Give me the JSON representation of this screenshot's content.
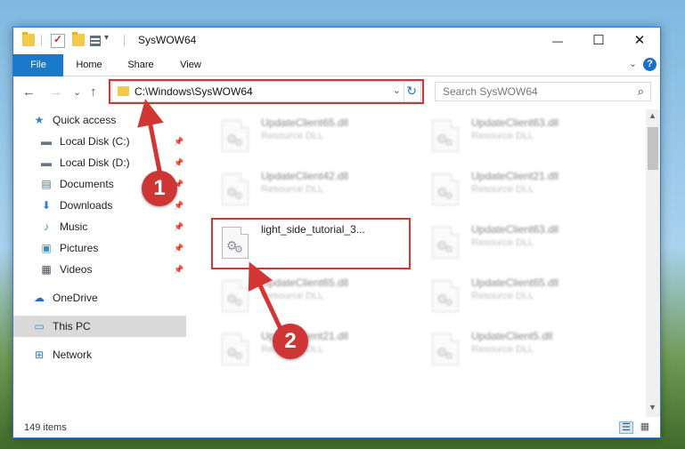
{
  "window": {
    "title": "SysWOW64",
    "controls": {
      "minimize": "—",
      "maximize": "☐",
      "close": "✕"
    }
  },
  "ribbon": {
    "tabs": [
      {
        "label": "File"
      },
      {
        "label": "Home"
      },
      {
        "label": "Share"
      },
      {
        "label": "View"
      }
    ],
    "expand": "⌄",
    "help": "?"
  },
  "nav": {
    "back": "←",
    "forward": "→",
    "recent": "⌄",
    "up": "↑",
    "address": "C:\\Windows\\SysWOW64",
    "address_caret": "⌄",
    "refresh": "↻",
    "search_placeholder": "Search SysWOW64",
    "search_icon": "⌕"
  },
  "sidebar": {
    "items": [
      {
        "label": "Quick access",
        "icon": "star-icon",
        "glyph": "★",
        "color": "#2f7fd6",
        "pinned": false
      },
      {
        "label": "Local Disk (C:)",
        "icon": "drive-icon",
        "glyph": "▬",
        "color": "#6a7580",
        "pinned": true
      },
      {
        "label": "Local Disk (D:)",
        "icon": "drive-icon",
        "glyph": "▬",
        "color": "#6a7580",
        "pinned": true
      },
      {
        "label": "Documents",
        "icon": "documents-icon",
        "glyph": "▤",
        "color": "#4a6f99",
        "pinned": true
      },
      {
        "label": "Downloads",
        "icon": "downloads-icon",
        "glyph": "⬇",
        "color": "#2f7fd6",
        "pinned": true
      },
      {
        "label": "Music",
        "icon": "music-icon",
        "glyph": "♪",
        "color": "#2f7fd6",
        "pinned": true
      },
      {
        "label": "Pictures",
        "icon": "pictures-icon",
        "glyph": "▣",
        "color": "#3a8fc9",
        "pinned": true
      },
      {
        "label": "Videos",
        "icon": "videos-icon",
        "glyph": "▦",
        "color": "#404a55",
        "pinned": true
      },
      {
        "label": "OneDrive",
        "icon": "onedrive-icon",
        "glyph": "☁",
        "color": "#1e6fc7",
        "pinned": false
      },
      {
        "label": "This PC",
        "icon": "computer-icon",
        "glyph": "▭",
        "color": "#3a8fc9",
        "pinned": false,
        "selected": true
      },
      {
        "label": "Network",
        "icon": "network-icon",
        "glyph": "⊞",
        "color": "#2f7fd6",
        "pinned": false
      }
    ],
    "pin_glyph": "📌"
  },
  "files": [
    {
      "name": "UpdateClient65.dll",
      "desc": "Resource DLL",
      "blurred": true
    },
    {
      "name": "UpdateClient63.dll",
      "desc": "Resource DLL",
      "blurred": true
    },
    {
      "name": "UpdateClient42.dll",
      "desc": "Resource DLL",
      "blurred": true
    },
    {
      "name": "UpdateClient21.dll",
      "desc": "Resource DLL",
      "blurred": true
    },
    {
      "name": "light_side_tutorial_3...",
      "desc": "",
      "blurred": false
    },
    {
      "name": "UpdateClient63.dll",
      "desc": "Resource DLL",
      "blurred": true
    },
    {
      "name": "UpdateClient65.dll",
      "desc": "Resource DLL",
      "blurred": true
    },
    {
      "name": "UpdateClient65.dll",
      "desc": "Resource DLL",
      "blurred": true
    },
    {
      "name": "UpdateClient21.dll",
      "desc": "Resource DLL",
      "blurred": true
    },
    {
      "name": "UpdateClient5.dll",
      "desc": "Resource DLL",
      "blurred": true
    }
  ],
  "status": {
    "count": "149 items"
  },
  "scroll": {
    "up": "▲",
    "down": "▼"
  },
  "callouts": {
    "one": "1",
    "two": "2",
    "color": "#d33434"
  },
  "view_icons": {
    "details": "☰",
    "tiles": "▦"
  }
}
